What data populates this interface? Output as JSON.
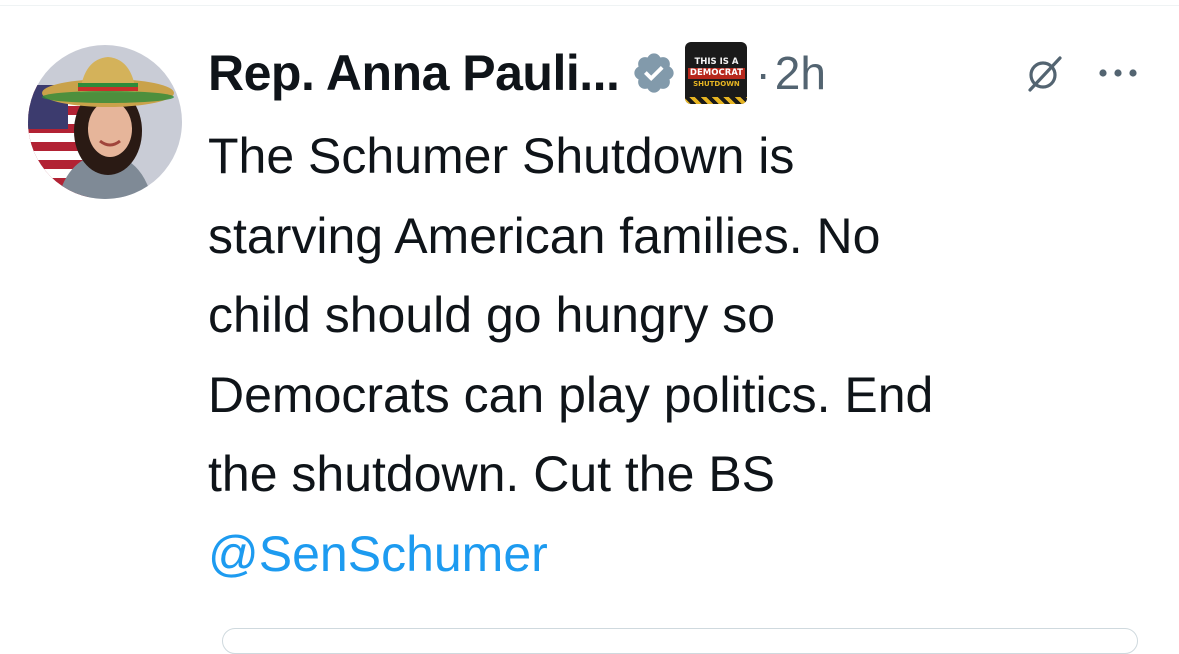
{
  "tweet": {
    "author": {
      "display_name": "Rep. Anna Pauli...",
      "avatar_icon": "avatar-photo",
      "verified_icon": "verified-badge-icon",
      "affiliation_badge": {
        "line1": "THIS IS A",
        "line2": "DEMOCRAT",
        "line3": "SHUTDOWN"
      }
    },
    "separator": "·",
    "timestamp": "2h",
    "text": "The Schumer Shutdown is\nstarving American families. No\nchild should go hungry so\nDemocrats can play politics. End\nthe shutdown. Cut the BS",
    "mention": "@SenSchumer",
    "actions": {
      "grok_icon": "grok-icon",
      "more_icon": "more-icon"
    }
  },
  "colors": {
    "text": "#0f1419",
    "secondary": "#536471",
    "link": "#1d9bf0",
    "verified": "#829aab"
  }
}
